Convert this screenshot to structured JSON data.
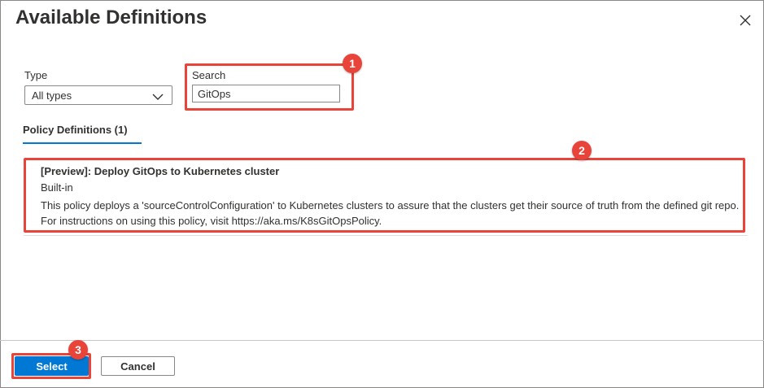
{
  "dialog": {
    "title": "Available Definitions",
    "close_icon": "close-icon"
  },
  "filters": {
    "type_label": "Type",
    "type_value": "All types",
    "search_label": "Search",
    "search_value": "GitOps"
  },
  "tab": {
    "label": "Policy Definitions (1)"
  },
  "policies": [
    {
      "name": "[Preview]: Deploy GitOps to Kubernetes cluster",
      "type": "Built-in",
      "description": "This policy deploys a 'sourceControlConfiguration' to Kubernetes clusters to assure that the clusters get their source of truth from the defined git repo. For instructions on using this policy, visit https://aka.ms/K8sGitOpsPolicy."
    }
  ],
  "footer": {
    "select_label": "Select",
    "cancel_label": "Cancel"
  },
  "callouts": [
    "1",
    "2",
    "3"
  ],
  "colors": {
    "accent": "#0078d4",
    "highlight": "#e8443a"
  }
}
